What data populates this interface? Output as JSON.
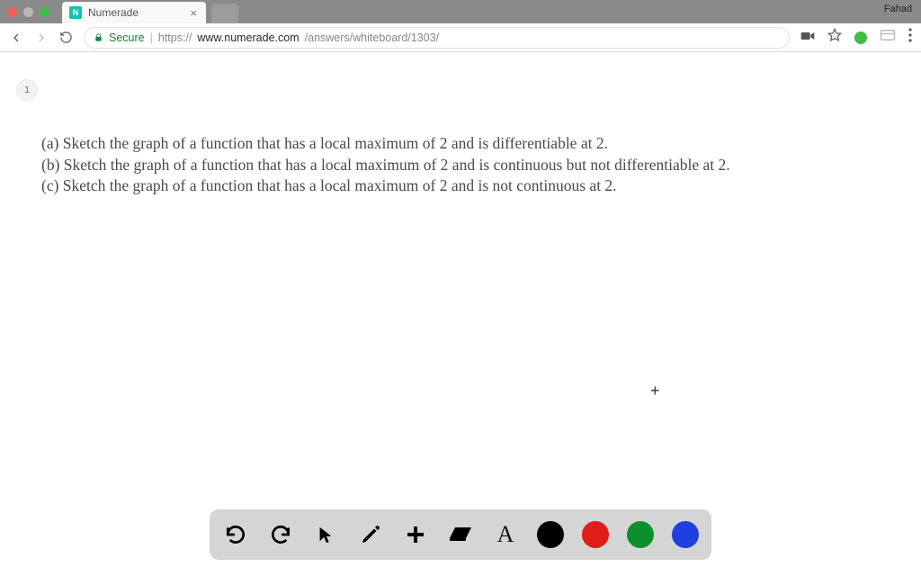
{
  "tab": {
    "favicon_letter": "N",
    "title": "Numerade",
    "close": "×"
  },
  "os": {
    "profile": "Fahad"
  },
  "address": {
    "secure_label": "Secure",
    "protocol": "https://",
    "host": "www.numerade.com",
    "path": "/answers/whiteboard/1303/"
  },
  "page": {
    "badge": "1"
  },
  "problem": {
    "line_a": "(a) Sketch the graph of a function that has a local maximum of 2 and is differentiable at 2.",
    "line_b": "(b) Sketch the graph of a function that has a local maximum of 2 and is continuous but not differentiable at 2.",
    "line_c": "(c) Sketch the graph of a function that has a local maximum of 2 and is not continuous at 2."
  },
  "toolbar": {
    "text_tool": "A",
    "colors": {
      "black": "#000000",
      "red": "#e21b1b",
      "green": "#0b8f2f",
      "blue": "#1f3fe0"
    }
  },
  "cursor": "+"
}
